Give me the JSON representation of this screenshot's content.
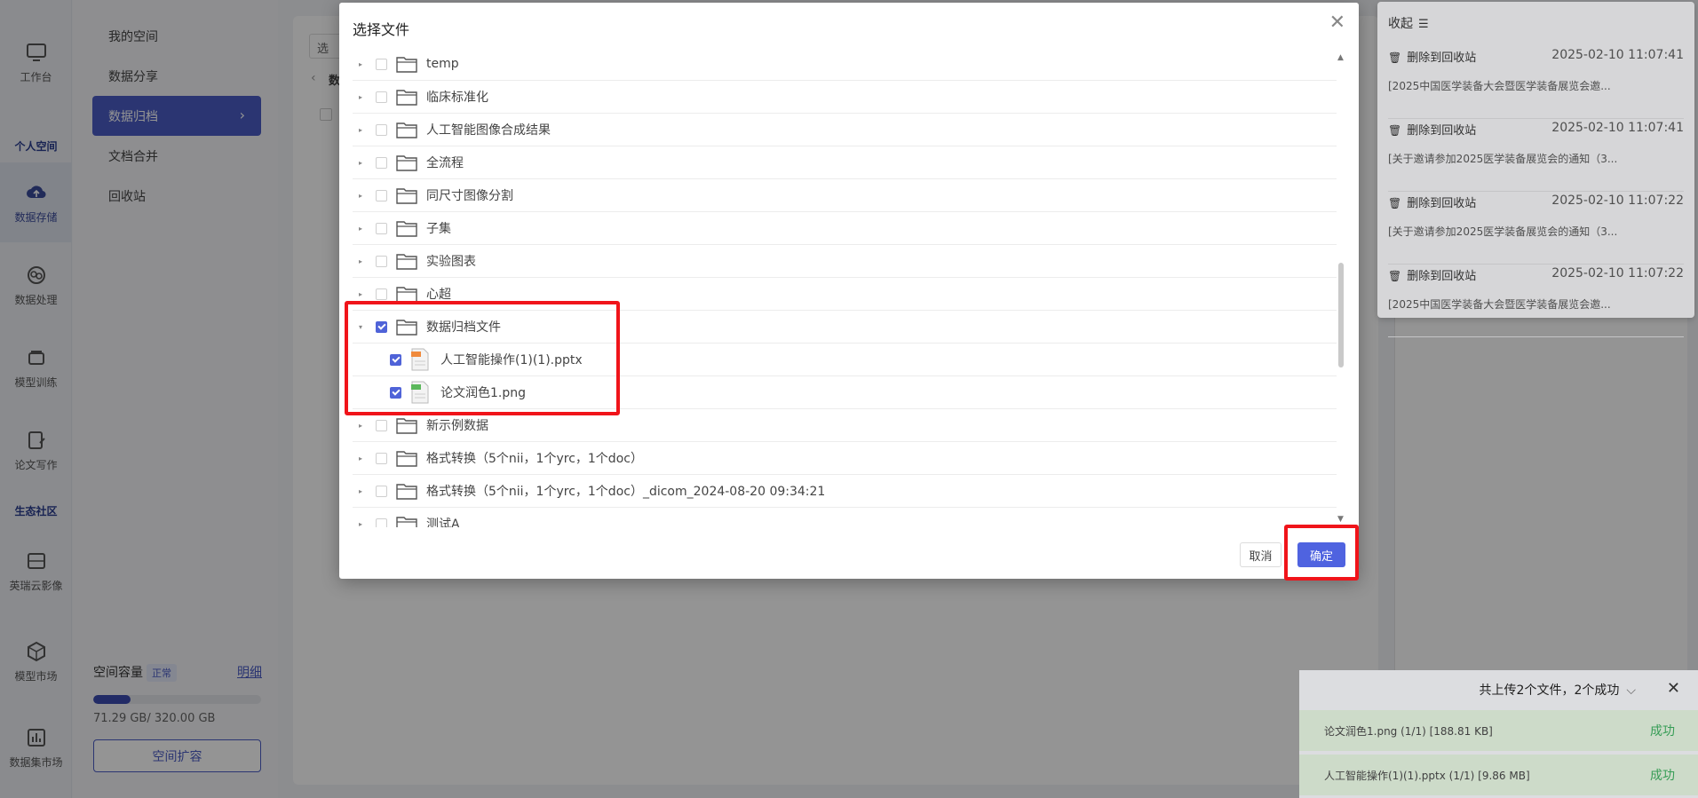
{
  "rail": {
    "workbench": "工作台",
    "section_personal": "个人空间",
    "storage": "数据存储",
    "processing": "数据处理",
    "training": "模型训练",
    "writing": "论文写作",
    "section_eco": "生态社区",
    "imaging": "英瑞云影像",
    "model_market": "模型市场",
    "dataset_market": "数据集市场"
  },
  "sidebar": {
    "items": [
      "我的空间",
      "数据分享",
      "数据归档",
      "文档合并",
      "回收站"
    ],
    "active_index": 2,
    "capacity_label": "空间容量",
    "capacity_status": "正常",
    "capacity_detail": "明细",
    "capacity_used_fraction": 0.2228,
    "capacity_text": "71.29 GB/ 320.00 GB",
    "expand_button": "空间扩容"
  },
  "main": {
    "select_button": "选择",
    "breadcrumb": "数"
  },
  "modal": {
    "title": "选择文件",
    "rows": [
      {
        "type": "folder",
        "name": "temp",
        "checked": false
      },
      {
        "type": "folder",
        "name": "临床标准化",
        "checked": false
      },
      {
        "type": "folder",
        "name": "人工智能图像合成结果",
        "checked": false
      },
      {
        "type": "folder",
        "name": "全流程",
        "checked": false
      },
      {
        "type": "folder",
        "name": "同尺寸图像分割",
        "checked": false
      },
      {
        "type": "folder",
        "name": "子集",
        "checked": false
      },
      {
        "type": "folder",
        "name": "实验图表",
        "checked": false
      },
      {
        "type": "folder",
        "name": "心超",
        "checked": false
      },
      {
        "type": "folder",
        "name": "数据归档文件",
        "checked": true,
        "expanded": true
      },
      {
        "type": "file",
        "name": "人工智能操作(1)(1).pptx",
        "checked": true,
        "icon": "pptx-file-icon"
      },
      {
        "type": "file",
        "name": "论文润色1.png",
        "checked": true,
        "icon": "png-file-icon"
      },
      {
        "type": "folder",
        "name": "新示例数据",
        "checked": false
      },
      {
        "type": "folder",
        "name": "格式转换（5个nii，1个yrc，1个doc）",
        "checked": false
      },
      {
        "type": "folder",
        "name": "格式转换（5个nii，1个yrc，1个doc）_dicom_2024-08-20 09:34:21",
        "checked": false
      },
      {
        "type": "folder",
        "name": "测试A",
        "checked": false
      }
    ],
    "cancel": "取消",
    "confirm": "确定"
  },
  "log": {
    "title": "收起",
    "entries": [
      {
        "action": "删除到回收站",
        "time": "2025-02-10 11:07:41",
        "desc": "[2025中国医学装备大会暨医学装备展览会邀..."
      },
      {
        "action": "删除到回收站",
        "time": "2025-02-10 11:07:41",
        "desc": "[关于邀请参加2025医学装备展览会的通知（3..."
      },
      {
        "action": "删除到回收站",
        "time": "2025-02-10 11:07:22",
        "desc": "[关于邀请参加2025医学装备展览会的通知（3..."
      },
      {
        "action": "删除到回收站",
        "time": "2025-02-10 11:07:22",
        "desc": "[2025中国医学装备大会暨医学装备展览会邀..."
      }
    ]
  },
  "upload": {
    "summary": "共上传2个文件，2个成功",
    "items": [
      {
        "file": "论文润色1.png   (1/1) [188.81 KB]",
        "status": "成功"
      },
      {
        "file": "人工智能操作(1)(1).pptx   (1/1) [9.86 MB]",
        "status": "成功"
      }
    ]
  },
  "colors": {
    "accent": "#4f63e0",
    "highlight": "#f0141a",
    "success": "#3aa55a"
  }
}
